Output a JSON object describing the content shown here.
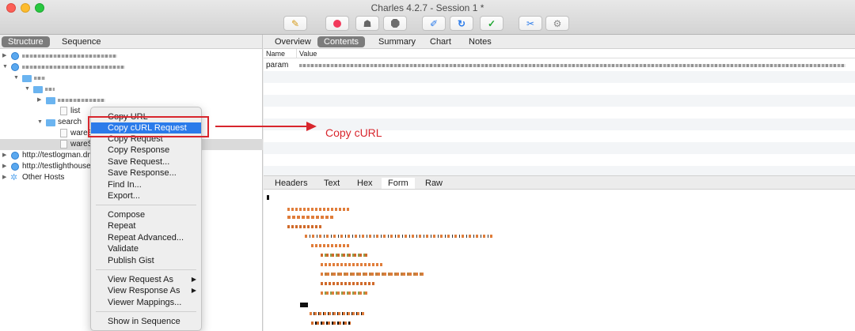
{
  "window": {
    "title": "Charles 4.2.7 - Session 1 *"
  },
  "toolbar": {
    "buttons": [
      {
        "name": "broom-icon",
        "glyph": "✎"
      },
      {
        "name": "record-icon",
        "glyph": ""
      },
      {
        "name": "turtle-icon",
        "glyph": "☗"
      },
      {
        "name": "breakpoint-icon",
        "glyph": ""
      },
      {
        "name": "pen-icon",
        "glyph": "✐"
      },
      {
        "name": "refresh-icon",
        "glyph": "↻"
      },
      {
        "name": "check-icon",
        "glyph": "✓"
      },
      {
        "name": "tools-icon",
        "glyph": "✂"
      },
      {
        "name": "settings-icon",
        "glyph": "⚙"
      }
    ]
  },
  "left": {
    "tabs": [
      "Structure",
      "Sequence"
    ],
    "tree": {
      "list": "list",
      "search": "search",
      "ware1": "wareS",
      "ware2": "wareSe",
      "host1": "http://testlogman.dma",
      "host2": "http://testlighthousea",
      "other": "Other Hosts"
    }
  },
  "context_menu": {
    "items": [
      "Copy URL",
      "Copy cURL Request",
      "Copy Request",
      "Copy Response",
      "Save Request...",
      "Save Response...",
      "Find In...",
      "Export...",
      "Compose",
      "Repeat",
      "Repeat Advanced...",
      "Validate",
      "Publish Gist",
      "View Request As",
      "View Response As",
      "Viewer Mappings...",
      "Show in Sequence"
    ]
  },
  "annotation": {
    "text": "Copy cURL",
    "color": "#d8262d"
  },
  "right": {
    "tabs": [
      "Overview",
      "Contents",
      "Summary",
      "Chart",
      "Notes"
    ],
    "table": {
      "col_name": "Name",
      "col_value": "Value",
      "row_name": "param"
    },
    "bottom_tabs": [
      "Headers",
      "Text",
      "Hex",
      "Form",
      "Raw"
    ]
  }
}
